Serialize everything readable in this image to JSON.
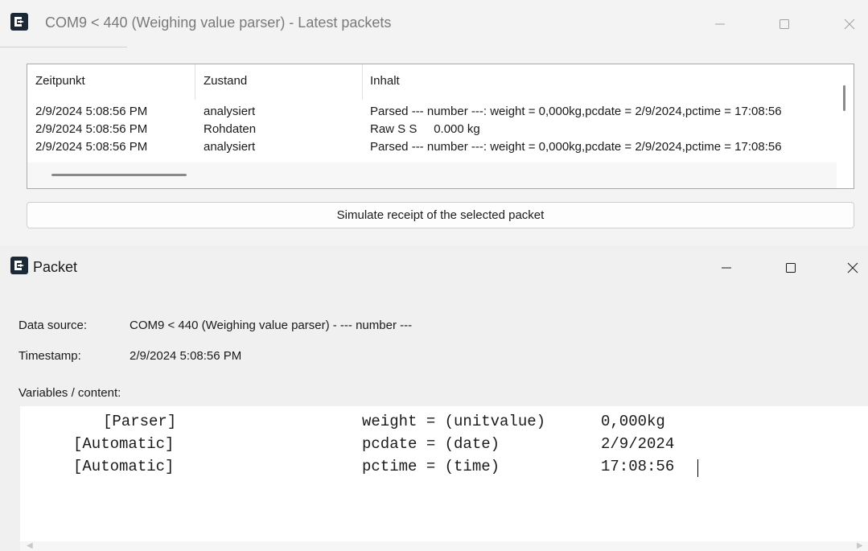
{
  "window1": {
    "title": "COM9 < 440 (Weighing value parser) - Latest packets",
    "columns": [
      "Zeitpunkt",
      "Zustand",
      "Inhalt"
    ],
    "rows": [
      [
        "2/9/2024 5:08:56 PM",
        "analysiert",
        "Parsed --- number ---: weight = 0,000kg,pcdate = 2/9/2024,pctime = 17:08:56"
      ],
      [
        "2/9/2024 5:08:56 PM",
        "Rohdaten",
        "Raw S S     0.000 kg"
      ],
      [
        "2/9/2024 5:08:56 PM",
        "analysiert",
        "Parsed --- number ---: weight = 0,000kg,pcdate = 2/9/2024,pctime = 17:08:56"
      ]
    ],
    "simulate_label": "Simulate receipt of the selected packet"
  },
  "window2": {
    "title": "Packet",
    "data_source_label": "Data source:",
    "data_source_value": "COM9 < 440 (Weighing value parser) - --- number ---",
    "timestamp_label": "Timestamp:",
    "timestamp_value": "2/9/2024 5:08:56 PM",
    "variables_label": "Variables / content:",
    "variables": [
      {
        "source": "[Parser]",
        "expr": "weight = (unitvalue)",
        "value": "0,000kg"
      },
      {
        "source": "[Automatic]",
        "expr": "pcdate = (date)",
        "value": "2/9/2024"
      },
      {
        "source": "[Automatic]",
        "expr": "pctime = (time)",
        "value": "17:08:56"
      }
    ]
  },
  "colors": {
    "app_icon": "#1b2836",
    "accent": "#0067c0"
  },
  "icons": [
    "app-logo-icon",
    "minimize-icon",
    "maximize-icon",
    "close-icon"
  ]
}
